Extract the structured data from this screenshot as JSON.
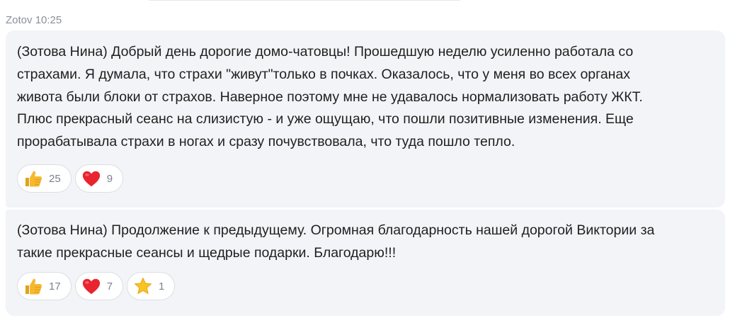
{
  "header": {
    "sender": "Zotov",
    "time": "10:25"
  },
  "messages": [
    {
      "text": "(Зотова Нина)  Добрый день дорогие домо-чатовцы! Прошедшую неделю усиленно работала со\nстрахами. Я думала, что страхи \"живут\"только в почках. Оказалось, что  у меня во всех органах\nживота были блоки от страхов. Наверное поэтому мне не удавалось нормализовать работу ЖКТ.\nПлюс прекрасный сеанс на слизистую - и уже ощущаю, что пошли позитивные изменения. Еще\nпрорабатывала страхи в ногах и сразу почувствовала, что туда пошло тепло.",
      "reactions": [
        {
          "icon": "thumbs-up-icon",
          "count": "25"
        },
        {
          "icon": "heart-icon",
          "count": "9"
        }
      ]
    },
    {
      "text": "(Зотова Нина) Продолжение к предыдущему. Огромная благодарность нашей дорогой Виктории  за\nтакие прекрасные сеансы и щедрые подарки. Благодарю!!!",
      "reactions": [
        {
          "icon": "thumbs-up-icon",
          "count": "17"
        },
        {
          "icon": "heart-icon",
          "count": "7"
        },
        {
          "icon": "star-icon",
          "count": "1"
        }
      ]
    }
  ],
  "colors": {
    "bubble": "#f2f4f7",
    "text": "#1f1f1f",
    "header": "#8a9099",
    "thumb": "#f5b82e",
    "heart": "#e8242f",
    "star": "#f7c325"
  }
}
